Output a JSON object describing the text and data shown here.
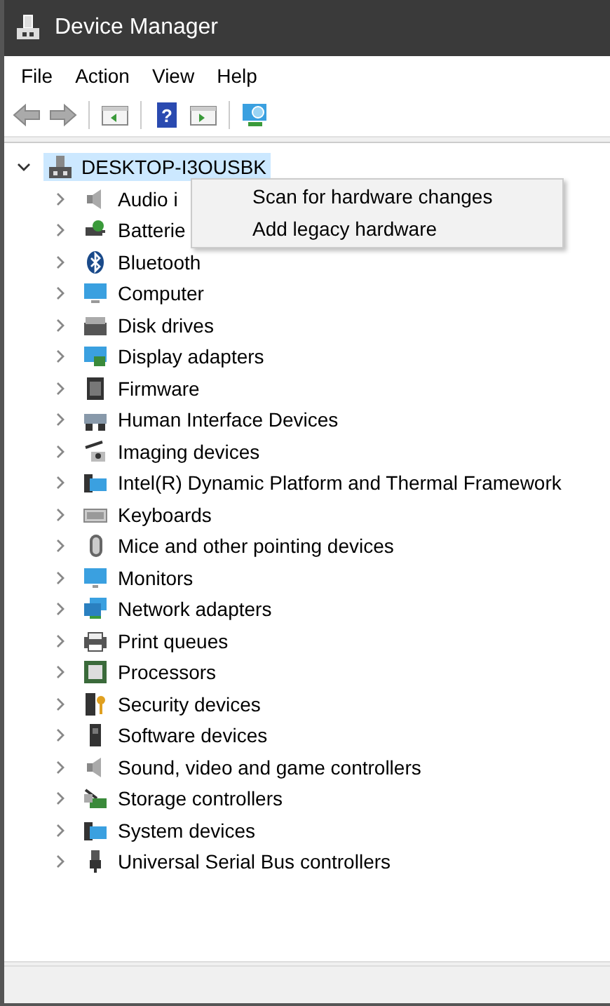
{
  "window": {
    "title": "Device Manager"
  },
  "menu": [
    "File",
    "Action",
    "View",
    "Help"
  ],
  "toolbar": {
    "help_glyph": "?"
  },
  "tree": {
    "label": "DESKTOP-I3OUSBK",
    "selected": true,
    "expanded": true,
    "children": [
      {
        "label": "Audio i",
        "expanded": false,
        "selected": false
      },
      {
        "label": "Batterie",
        "expanded": false,
        "selected": false
      },
      {
        "label": "Bluetooth",
        "expanded": false,
        "selected": false
      },
      {
        "label": "Computer",
        "expanded": false,
        "selected": false
      },
      {
        "label": "Disk drives",
        "expanded": false,
        "selected": false
      },
      {
        "label": "Display adapters",
        "expanded": false,
        "selected": false
      },
      {
        "label": "Firmware",
        "expanded": false,
        "selected": false
      },
      {
        "label": "Human Interface Devices",
        "expanded": false,
        "selected": false
      },
      {
        "label": "Imaging devices",
        "expanded": false,
        "selected": false
      },
      {
        "label": "Intel(R) Dynamic Platform and Thermal Framework",
        "expanded": false,
        "selected": false
      },
      {
        "label": "Keyboards",
        "expanded": false,
        "selected": false
      },
      {
        "label": "Mice and other pointing devices",
        "expanded": false,
        "selected": false
      },
      {
        "label": "Monitors",
        "expanded": false,
        "selected": false
      },
      {
        "label": "Network adapters",
        "expanded": false,
        "selected": false
      },
      {
        "label": "Print queues",
        "expanded": false,
        "selected": false
      },
      {
        "label": "Processors",
        "expanded": false,
        "selected": false
      },
      {
        "label": "Security devices",
        "expanded": false,
        "selected": false
      },
      {
        "label": "Software devices",
        "expanded": false,
        "selected": false
      },
      {
        "label": "Sound, video and game controllers",
        "expanded": false,
        "selected": false
      },
      {
        "label": "Storage controllers",
        "expanded": false,
        "selected": false
      },
      {
        "label": "System devices",
        "expanded": false,
        "selected": false
      },
      {
        "label": "Universal Serial Bus controllers",
        "expanded": false,
        "selected": false
      }
    ]
  },
  "context_menu": [
    "Scan for hardware changes",
    "Add legacy hardware"
  ]
}
